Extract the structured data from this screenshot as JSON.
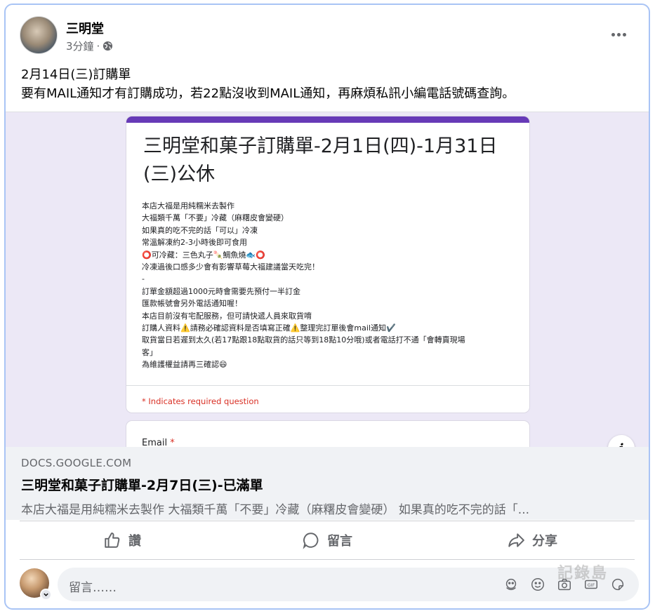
{
  "post": {
    "author": "三明堂",
    "time": "3分鐘",
    "separator": "·",
    "line1": "2月14日(三)訂購單",
    "line2": "要有MAIL通知才有訂購成功，若22點沒收到MAIL通知，再麻煩私訊小編電話號碼查詢。"
  },
  "form_preview": {
    "title": "三明堂和菓子訂購單-2月1日(四)-1月31日(三)公休",
    "description_lines": [
      "本店大福是用純糯米去製作",
      "大福類千萬「不要」冷藏（麻糬皮會變硬）",
      "如果真的吃不完的話「可以」冷凍",
      "常溫解凍約2-3小時後即可食用",
      "⭕可冷藏：三色丸子🍡鯛魚燒🐟⭕",
      "冷凍過後口感多少會有影響草莓大福建議當天吃完！",
      "-",
      "訂單金額超過1000元時會需要先預付一半訂金",
      "匯款帳號會另外電話通知喔！",
      "本店目前沒有宅配服務，但可請快遞人員來取貨唷",
      "訂購人資料⚠️請務必確認資料是否填寫正確⚠️整理完訂單後會mail通知✔️",
      "取貨當日若遲到太久(若17點跟18點取貨的話只等到18點10分哦)或者電話打不通「會轉賣現場",
      "客」",
      "為維護權益請再三確認😄"
    ],
    "required_note": "* Indicates required question",
    "email_label": "Email",
    "email_required_mark": "*"
  },
  "link": {
    "domain": "DOCS.GOOGLE.COM",
    "title": "三明堂和菓子訂購單-2月7日(三)-已滿單",
    "description": "本店大福是用純糯米去製作 大福類千萬「不要」冷藏（麻糬皮會變硬） 如果真的吃不完的話「..."
  },
  "actions": {
    "like": "讚",
    "comment": "留言",
    "share": "分享"
  },
  "comment_input": {
    "placeholder": "留言……"
  },
  "watermark": {
    "text": "記錄島"
  },
  "colors": {
    "form_accent": "#673ab7",
    "required": "#d93025",
    "secondary_text": "#65676b",
    "frame_border": "#a9c4f5"
  },
  "icons": [
    "globe-icon",
    "more-icon",
    "info-icon",
    "like-icon",
    "comment-icon",
    "share-icon",
    "sticker-icon",
    "emoji-icon",
    "camera-icon",
    "gif-icon",
    "avatar-sticker-icon"
  ]
}
